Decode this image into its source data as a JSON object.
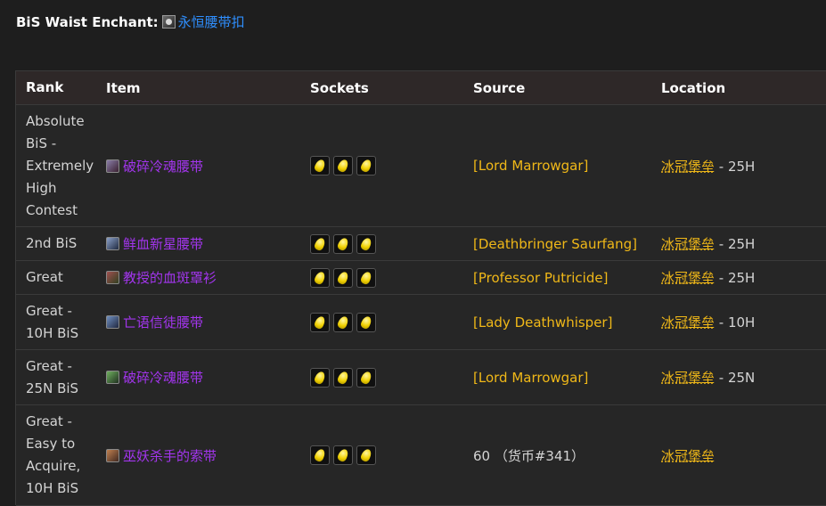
{
  "enchant": {
    "label": "BiS Waist Enchant",
    "colon": ":",
    "link": "永恒腰带扣"
  },
  "headers": {
    "rank": "Rank",
    "item": "Item",
    "sockets": "Sockets",
    "source": "Source",
    "location": "Location"
  },
  "rows": [
    {
      "rank": "Absolute BiS - Extremely High Contest",
      "item": "破碎冷魂腰带",
      "source": "[Lord Marrowgar]",
      "location": "冰冠堡垒",
      "difficulty": " - 25H"
    },
    {
      "rank": "2nd BiS",
      "item": "鲜血新星腰带",
      "source": "[Deathbringer Saurfang]",
      "location": "冰冠堡垒",
      "difficulty": " - 25H"
    },
    {
      "rank": "Great",
      "item": "教授的血斑罩衫",
      "source": "[Professor Putricide]",
      "location": "冰冠堡垒",
      "difficulty": " - 25H"
    },
    {
      "rank": "Great - 10H BiS",
      "item": "亡语信徒腰带",
      "source": "[Lady Deathwhisper]",
      "location": "冰冠堡垒",
      "difficulty": " - 10H"
    },
    {
      "rank": "Great - 25N BiS",
      "item": "破碎冷魂腰带",
      "source": "[Lord Marrowgar]",
      "location": "冰冠堡垒",
      "difficulty": " - 25N"
    },
    {
      "rank": "Great - Easy to Acquire, 10H BiS",
      "item": "巫妖杀手的索带",
      "source": "60 （货币#341）",
      "location": "冰冠堡垒",
      "difficulty": ""
    }
  ],
  "icons": {
    "enchant": "belt-buckle-icon",
    "socket": "yellow-gem-socket-icon"
  },
  "colors": {
    "item_epic": "#a335ee",
    "source_link": "#f0b818",
    "enchant_link": "#2f8fff"
  }
}
